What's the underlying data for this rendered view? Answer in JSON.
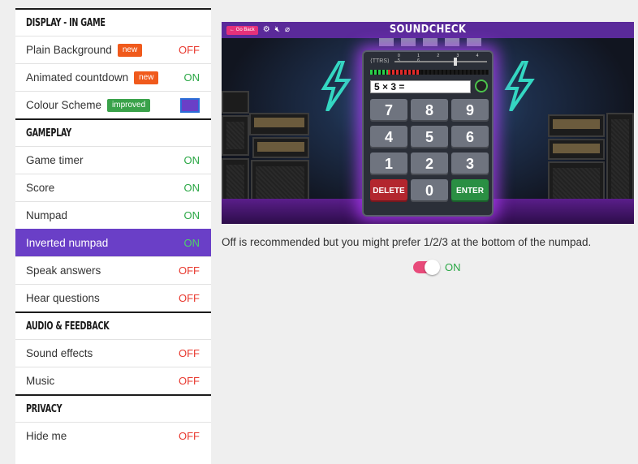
{
  "sections": [
    {
      "title": "DISPLAY - IN GAME",
      "rows": [
        {
          "label": "Plain Background",
          "badge": "new",
          "value": "OFF"
        },
        {
          "label": "Animated countdown",
          "badge": "new",
          "value": "ON"
        },
        {
          "label": "Colour Scheme",
          "badge": "improved",
          "value": "",
          "swatch_color": "#6a3fc7"
        }
      ]
    },
    {
      "title": "GAMEPLAY",
      "rows": [
        {
          "label": "Game timer",
          "value": "ON"
        },
        {
          "label": "Score",
          "value": "ON"
        },
        {
          "label": "Numpad",
          "value": "ON"
        },
        {
          "label": "Inverted numpad",
          "value": "ON",
          "selected": true
        },
        {
          "label": "Speak answers",
          "value": "OFF"
        },
        {
          "label": "Hear questions",
          "value": "OFF"
        }
      ]
    },
    {
      "title": "AUDIO & FEEDBACK",
      "rows": [
        {
          "label": "Sound effects",
          "value": "OFF"
        },
        {
          "label": "Music",
          "value": "OFF"
        }
      ]
    },
    {
      "title": "PRIVACY",
      "rows": [
        {
          "label": "Hide me",
          "value": "OFF"
        }
      ]
    }
  ],
  "preview": {
    "go_back": "← Go Back",
    "title": "SOUNDCHECK",
    "question": "5 × 3 =",
    "keys": [
      "7",
      "8",
      "9",
      "4",
      "5",
      "6",
      "1",
      "2",
      "3",
      "DELETE",
      "0",
      "ENTER"
    ],
    "meter_ticks": "0 1 2 3 4 5 6"
  },
  "hint": "Off is recommended but you might prefer 1/2/3 at the bottom of the numpad.",
  "toggle": {
    "state_label": "ON",
    "color": "#e84a7a"
  },
  "colors": {
    "accent": "#6a3fc7",
    "on": "#2aa745",
    "off": "#e8392f",
    "badge_new": "#f05a1c",
    "badge_improved": "#3aa24a"
  }
}
